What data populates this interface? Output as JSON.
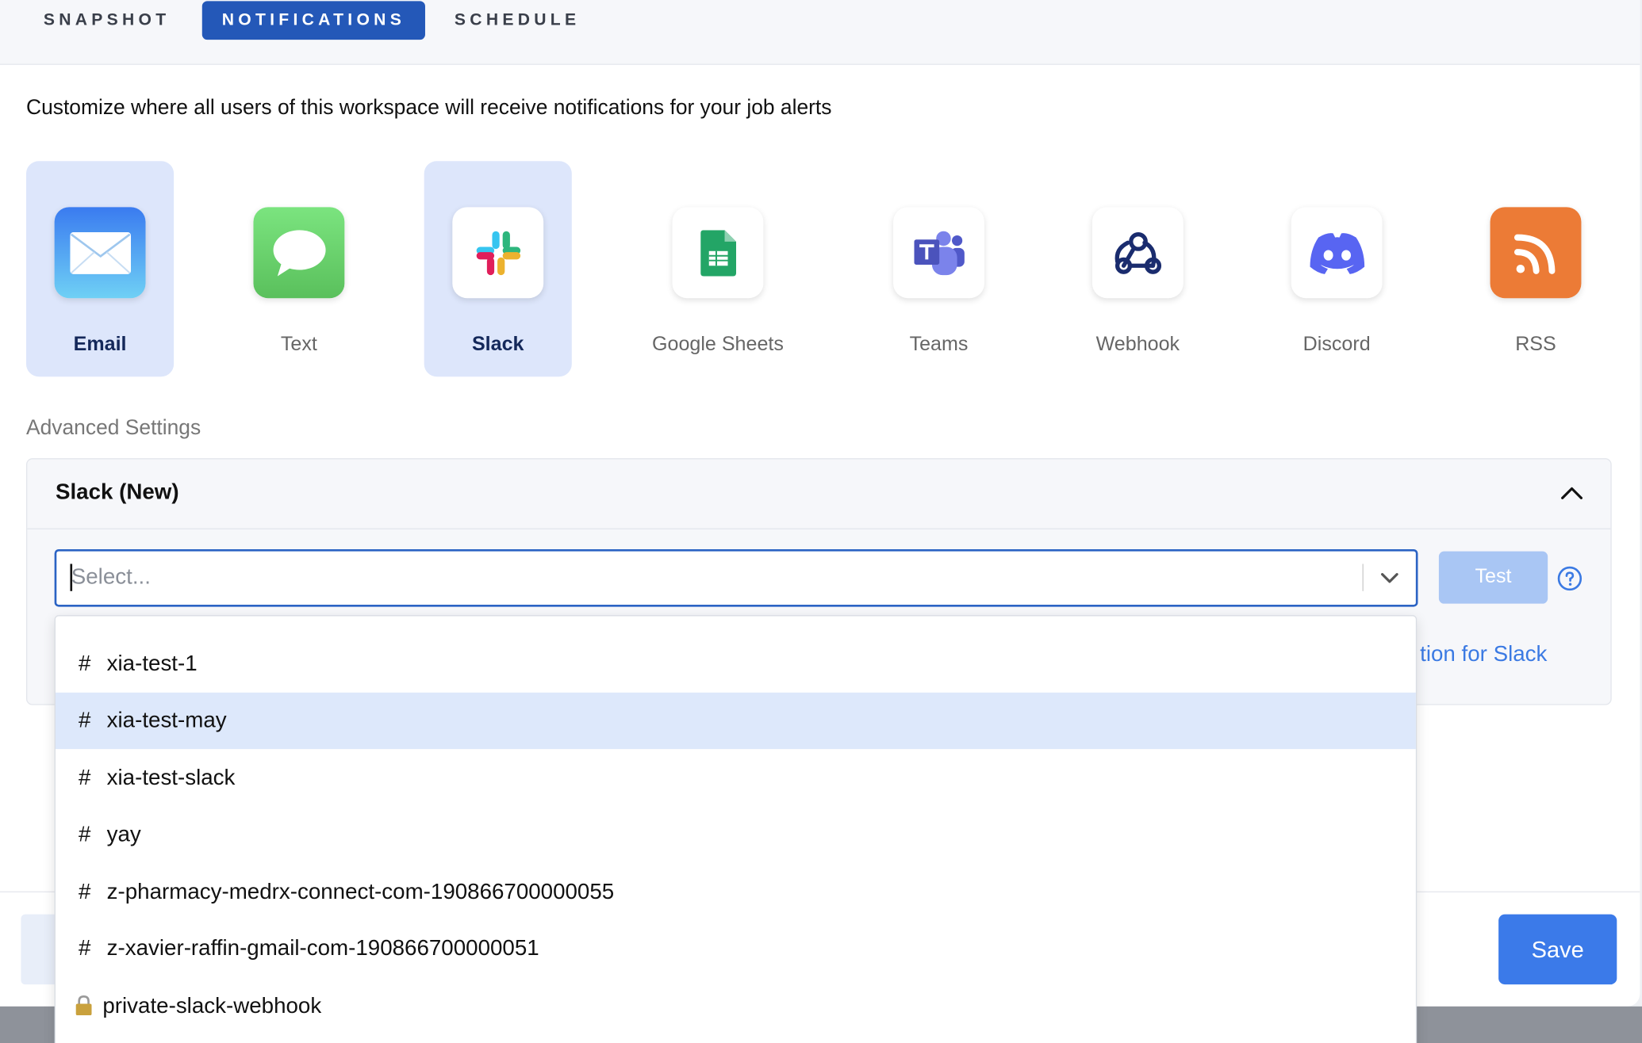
{
  "tabs": [
    {
      "label": "SNAPSHOT",
      "active": false
    },
    {
      "label": "NOTIFICATIONS",
      "active": true
    },
    {
      "label": "SCHEDULE",
      "active": false
    }
  ],
  "intro_text": "Customize where all users of this workspace will receive notifications for your job alerts",
  "channels": [
    {
      "label": "Email",
      "icon": "email-icon",
      "selected": true
    },
    {
      "label": "Text",
      "icon": "message-icon",
      "selected": false
    },
    {
      "label": "Slack",
      "icon": "slack-icon",
      "selected": true
    },
    {
      "label": "Google Sheets",
      "icon": "google-sheets-icon",
      "selected": false
    },
    {
      "label": "Teams",
      "icon": "teams-icon",
      "selected": false
    },
    {
      "label": "Webhook",
      "icon": "webhook-icon",
      "selected": false
    },
    {
      "label": "Discord",
      "icon": "discord-icon",
      "selected": false
    },
    {
      "label": "RSS",
      "icon": "rss-icon",
      "selected": false
    }
  ],
  "advanced": {
    "title": "Advanced Settings",
    "panel_title": "Slack (New)",
    "select_placeholder": "Select...",
    "test_label": "Test",
    "link_text_partial": "tion for Slack"
  },
  "dropdown_options": [
    {
      "label": "xia-test-1",
      "type": "public"
    },
    {
      "label": "xia-test-may",
      "type": "public",
      "highlighted": true
    },
    {
      "label": "xia-test-slack",
      "type": "public"
    },
    {
      "label": "yay",
      "type": "public"
    },
    {
      "label": "z-pharmacy-medrx-connect-com-190866700000055",
      "type": "public"
    },
    {
      "label": "z-xavier-raffin-gmail-com-190866700000051",
      "type": "public"
    },
    {
      "label": "private-slack-webhook",
      "type": "private"
    }
  ],
  "footer": {
    "save_label": "Save"
  },
  "colors": {
    "accent": "#2458b8",
    "selected_tile_bg": "#dde6fb",
    "save_button": "#3b7ae9",
    "test_button_disabled": "#a9c6f4",
    "highlight_row": "#dde8fb"
  }
}
